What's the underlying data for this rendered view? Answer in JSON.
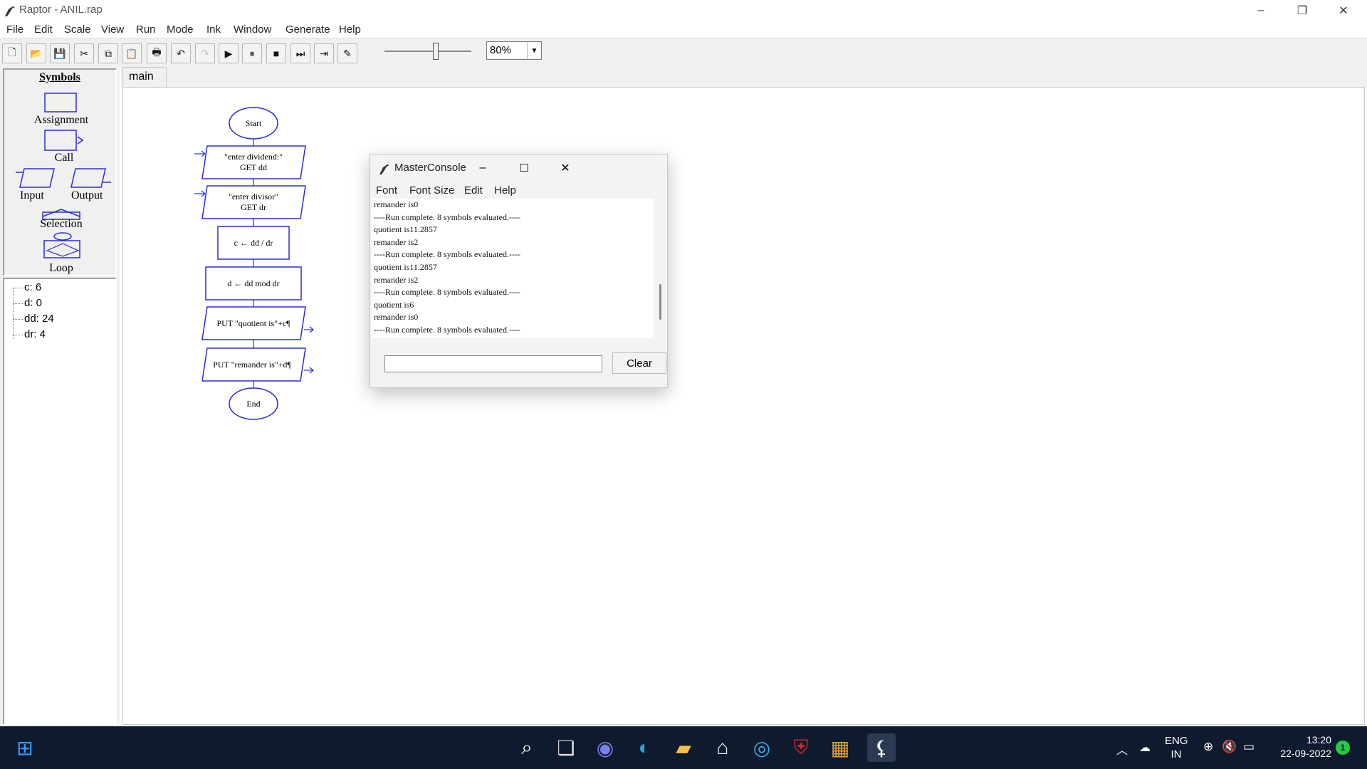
{
  "window": {
    "title": "Raptor - ANIL.rap",
    "controls": {
      "minimize": "–",
      "restore": "❐",
      "close": "✕"
    }
  },
  "menubar": [
    "File",
    "Edit",
    "Scale",
    "View",
    "Run",
    "Mode",
    "Ink",
    "Window",
    "Generate",
    "Help"
  ],
  "toolbar": {
    "buttons": [
      {
        "icon": "new-file-icon",
        "glyph": "🗋"
      },
      {
        "icon": "open-folder-icon",
        "glyph": "📂"
      },
      {
        "icon": "save-icon",
        "glyph": "💾"
      },
      {
        "icon": "cut-icon",
        "glyph": "✂"
      },
      {
        "icon": "copy-icon",
        "glyph": "⧉"
      },
      {
        "icon": "paste-icon",
        "glyph": "📋"
      },
      {
        "icon": "print-icon",
        "glyph": "🖶"
      },
      {
        "icon": "undo-icon",
        "glyph": "↶"
      },
      {
        "icon": "redo-icon",
        "glyph": "↷"
      },
      {
        "icon": "play-icon",
        "glyph": "▶"
      },
      {
        "icon": "pause-icon",
        "glyph": "⏸"
      },
      {
        "icon": "stop-icon",
        "glyph": "■"
      },
      {
        "icon": "step-icon",
        "glyph": "⏭"
      },
      {
        "icon": "run-to-cursor-icon",
        "glyph": "⇥"
      },
      {
        "icon": "pen-icon",
        "glyph": "✎"
      }
    ],
    "speed_level": 0.6,
    "zoom": "80%"
  },
  "symbols": {
    "header": "Symbols",
    "assignment": "Assignment",
    "call": "Call",
    "input": "Input",
    "output": "Output",
    "selection": "Selection",
    "loop": "Loop"
  },
  "variables": [
    "c: 6",
    "d: 0",
    "dd: 24",
    "dr: 4"
  ],
  "tabs": [
    "main"
  ],
  "flowchart": {
    "start": "Start",
    "input1_line1": "\"enter dividend:\"",
    "input1_line2": "GET dd",
    "input2_line1": "\"enter divisor\"",
    "input2_line2": "GET dr",
    "assign1": "c ← dd / dr",
    "assign2": "d ← dd  mod dr",
    "output1": "PUT \"quotient is\"+c¶",
    "output2": "PUT \"remander is\"+d¶",
    "end": "End"
  },
  "console": {
    "title": "MasterConsole",
    "menu": [
      "Font",
      "Font Size",
      "Edit",
      "Help"
    ],
    "lines": [
      "remander is0",
      "----Run complete.  8 symbols evaluated.----",
      "quotient is11.2857",
      "remander is2",
      "----Run complete.  8 symbols evaluated.----",
      "quotient is11.2857",
      "remander is2",
      "----Run complete.  8 symbols evaluated.----",
      "quotient is6",
      "remander is0",
      "----Run complete.  8 symbols evaluated.----"
    ],
    "input_value": "",
    "clear_label": "Clear"
  },
  "taskbar": {
    "apps": [
      "start-icon",
      "search-icon",
      "task-view-icon",
      "chat-icon",
      "edge-icon",
      "file-explorer-icon",
      "store-icon",
      "browser-icon",
      "mcafee-icon",
      "office-icon",
      "raptor-icon"
    ],
    "language_line1": "ENG",
    "language_line2": "IN",
    "time": "13:20",
    "date": "22-09-2022",
    "notification_count": "1"
  }
}
